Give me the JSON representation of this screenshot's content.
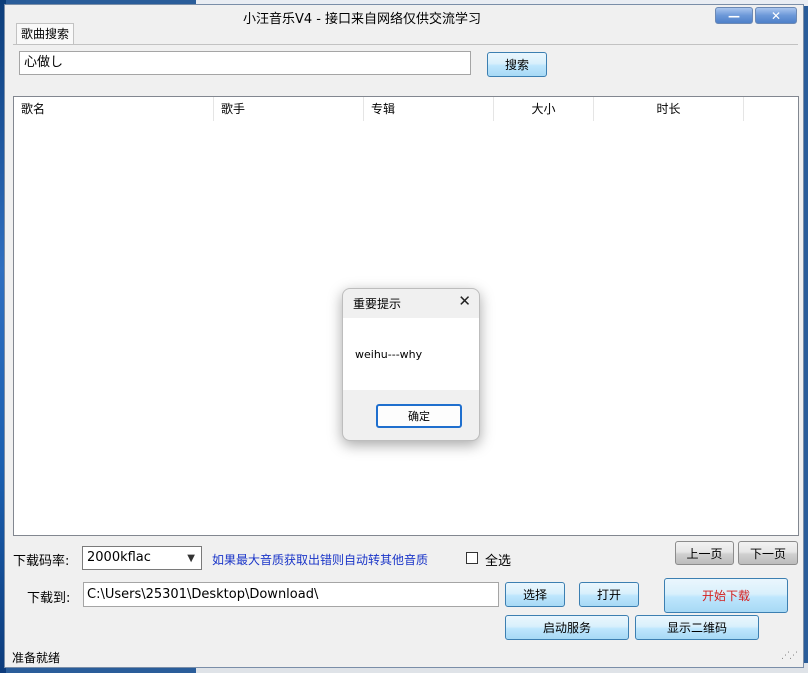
{
  "window": {
    "title": "小汪音乐V4 - 接口来自网络仅供交流学习",
    "minimize_glyph": "—",
    "close_glyph": "✕"
  },
  "search": {
    "tab_label": "歌曲搜索",
    "query": "心做し",
    "button_label": "搜索"
  },
  "list": {
    "columns": [
      "歌名",
      "歌手",
      "专辑",
      "大小",
      "时长"
    ]
  },
  "controls": {
    "bitrate_label": "下载码率:",
    "bitrate_value": "2000kflac",
    "bitrate_hint": "如果最大音质获取出错则自动转其他音质",
    "select_all_label": "全选",
    "select_all_checked": false,
    "prev_page_label": "上一页",
    "next_page_label": "下一页",
    "download_to_label": "下载到:",
    "download_path": "C:\\Users\\25301\\Desktop\\Download\\",
    "choose_label": "选择",
    "open_label": "打开",
    "start_download_label": "开始下载",
    "start_service_label": "启动服务",
    "show_qr_label": "显示二维码"
  },
  "status": {
    "text": "准备就绪"
  },
  "dialog": {
    "title": "重要提示",
    "message": "weihu---why",
    "ok_label": "确定"
  },
  "colors": {
    "hint_text": "#1a35c8",
    "start_download_text": "#d42020",
    "button_blue_border": "#3c7fb1"
  }
}
